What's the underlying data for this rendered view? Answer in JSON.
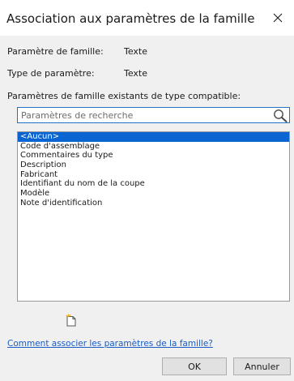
{
  "window": {
    "title": "Association aux paramètres de la famille",
    "close_icon": "close-icon"
  },
  "info": {
    "family_param_label": "Paramètre de famille:",
    "family_param_value": "Texte",
    "param_type_label": "Type de paramètre:",
    "param_type_value": "Texte",
    "existing_params_label": "Paramètres de famille existants de type compatible:"
  },
  "search": {
    "placeholder": "Paramètres de recherche",
    "value": "",
    "icon": "search-icon"
  },
  "list": {
    "items": [
      "<Aucun>",
      "Code d'assemblage",
      "Commentaires du type",
      "Description",
      "Fabricant",
      "Identifiant du nom de la coupe",
      "Modèle",
      "Note d'identification"
    ],
    "selected_index": 0
  },
  "toolbar": {
    "new_param_icon": "new-parameter-icon"
  },
  "help": {
    "link_text": "Comment associer les paramètres de la famille?"
  },
  "buttons": {
    "ok_label": "OK",
    "cancel_label": "Annuler"
  },
  "colors": {
    "selection": "#0a64d2",
    "link": "#1a5cc4",
    "focus_border": "#1e73c8",
    "dialog_bg": "#f0f0f0"
  }
}
